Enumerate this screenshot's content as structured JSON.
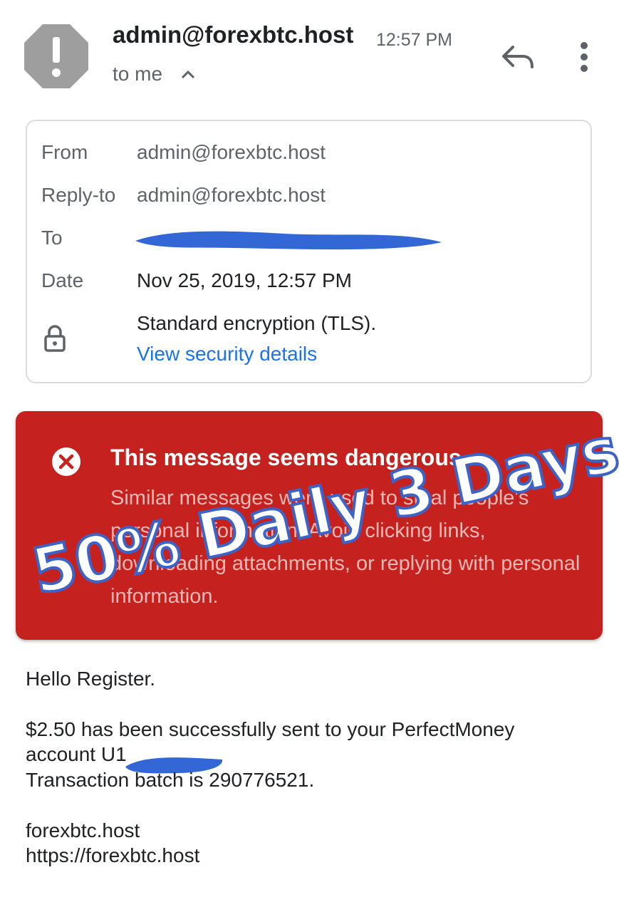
{
  "header": {
    "sender": "admin@forexbtc.host",
    "time": "12:57 PM",
    "to_label": "to me",
    "icons": [
      "warning-avatar-icon",
      "chevron-up-icon",
      "reply-icon",
      "more-vert-icon"
    ]
  },
  "details": {
    "from_label": "From",
    "from_value": "admin@forexbtc.host",
    "replyto_label": "Reply-to",
    "replyto_value": "admin@forexbtc.host",
    "to_label": "To",
    "date_label": "Date",
    "date_value": "Nov 25, 2019, 12:57 PM",
    "encryption": "Standard encryption (TLS).",
    "security_link": "View security details"
  },
  "warning": {
    "title": "This message seems dangerous",
    "body": "Similar messages were used to steal people's personal information. Avoid clicking links, downloading attachments, or replying with personal information."
  },
  "overlay": {
    "text": "50% Daily 3 Days"
  },
  "message": {
    "greeting": "Hello Register.",
    "line1": "$2.50 has been successfully sent to your PerfectMoney",
    "line2": "account U1",
    "line3": "Transaction batch is 290776521.",
    "line4": "forexbtc.host",
    "line5": "https://forexbtc.host"
  },
  "colors": {
    "warning_bg": "#c5221f",
    "link": "#1a73e8",
    "redaction": "#3367d6",
    "overlay_stroke": "#3b63c8"
  }
}
